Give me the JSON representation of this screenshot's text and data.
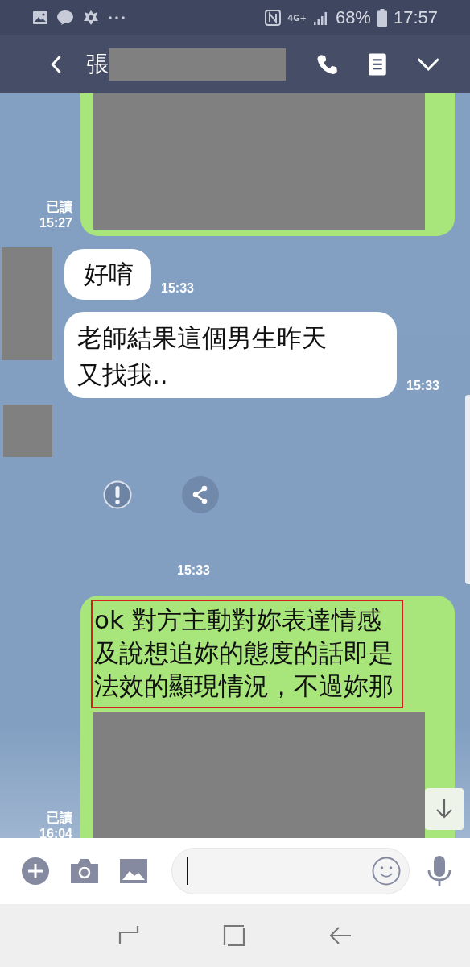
{
  "status_bar": {
    "network": "4G+",
    "battery": "68%",
    "time": "17:57"
  },
  "header": {
    "title": "張"
  },
  "messages": [
    {
      "kind": "outgoing",
      "redacted": true,
      "read": "已讀",
      "time": "15:27"
    },
    {
      "kind": "incoming",
      "avatar": true,
      "text": "好唷",
      "time": "15:33"
    },
    {
      "kind": "incoming",
      "avatar": false,
      "text": "老師結果這個男生昨天又找我..",
      "time": "15:33"
    },
    {
      "kind": "media",
      "avatar": true,
      "time": "15:33"
    },
    {
      "kind": "outgoing",
      "text": "ok 對方主動對妳表達情感及說想追妳的態度的話即是法效的顯現情況，不過妳那",
      "highlighted": true,
      "redacted": true,
      "read": "已讀",
      "time": "16:04"
    }
  ]
}
